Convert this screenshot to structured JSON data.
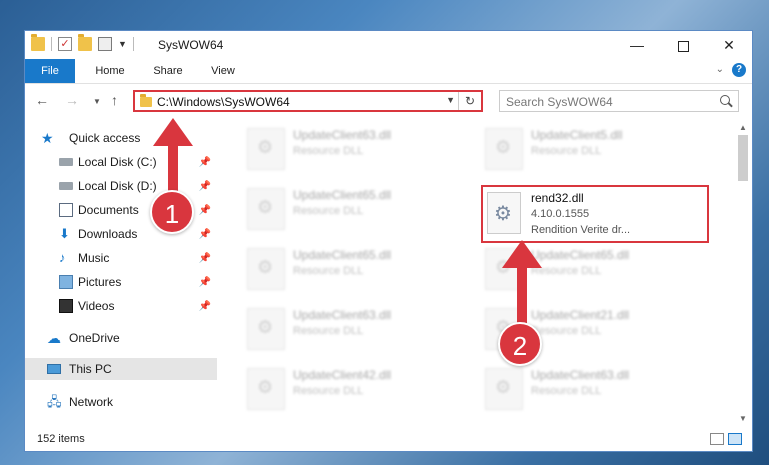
{
  "window": {
    "title": "SysWOW64",
    "controls": {
      "minimize": "—",
      "maximize": "",
      "close": "✕"
    }
  },
  "ribbon": {
    "tabs": [
      {
        "label": "File"
      },
      {
        "label": "Home"
      },
      {
        "label": "Share"
      },
      {
        "label": "View"
      }
    ],
    "help": "?"
  },
  "navbar": {
    "address": "C:\\Windows\\SysWOW64",
    "search_placeholder": "Search SysWOW64"
  },
  "sidebar": {
    "items": [
      {
        "label": "Quick access",
        "icon": "star-icon"
      },
      {
        "label": "Local Disk (C:)",
        "icon": "drive-icon",
        "pinned": true
      },
      {
        "label": "Local Disk (D:)",
        "icon": "drive-icon",
        "pinned": true
      },
      {
        "label": "Documents",
        "icon": "documents-icon",
        "pinned": true
      },
      {
        "label": "Downloads",
        "icon": "downloads-icon",
        "pinned": true
      },
      {
        "label": "Music",
        "icon": "music-icon",
        "pinned": true
      },
      {
        "label": "Pictures",
        "icon": "pictures-icon",
        "pinned": true
      },
      {
        "label": "Videos",
        "icon": "videos-icon",
        "pinned": true
      },
      {
        "label": "OneDrive",
        "icon": "cloud-icon"
      },
      {
        "label": "This PC",
        "icon": "computer-icon",
        "selected": true
      },
      {
        "label": "Network",
        "icon": "network-icon"
      }
    ]
  },
  "files": [
    {
      "name": "UpdateClient63.dll",
      "type": "Resource DLL"
    },
    {
      "name": "UpdateClient5.dll",
      "type": "Resource DLL"
    },
    {
      "name": "UpdateClient65.dll",
      "type": "Resource DLL"
    },
    {
      "name": "UpdateClient65.dll",
      "type": "Resource DLL"
    },
    {
      "name": "UpdateClient65.dll",
      "type": "Resource DLL"
    },
    {
      "name": "UpdateClient63.dll",
      "type": "Resource DLL"
    },
    {
      "name": "UpdateClient21.dll",
      "type": "Resource DLL"
    },
    {
      "name": "UpdateClient42.dll",
      "type": "Resource DLL"
    },
    {
      "name": "UpdateClient63.dll",
      "type": "Resource DLL"
    }
  ],
  "highlighted_file": {
    "name": "rend32.dll",
    "version": "4.10.0.1555",
    "description": "Rendition Verite dr..."
  },
  "status": {
    "item_count": "152 items"
  },
  "annotations": {
    "step1": "1",
    "step2": "2"
  },
  "colors": {
    "accent": "#1979ca",
    "annotation_red": "#d9363e"
  }
}
